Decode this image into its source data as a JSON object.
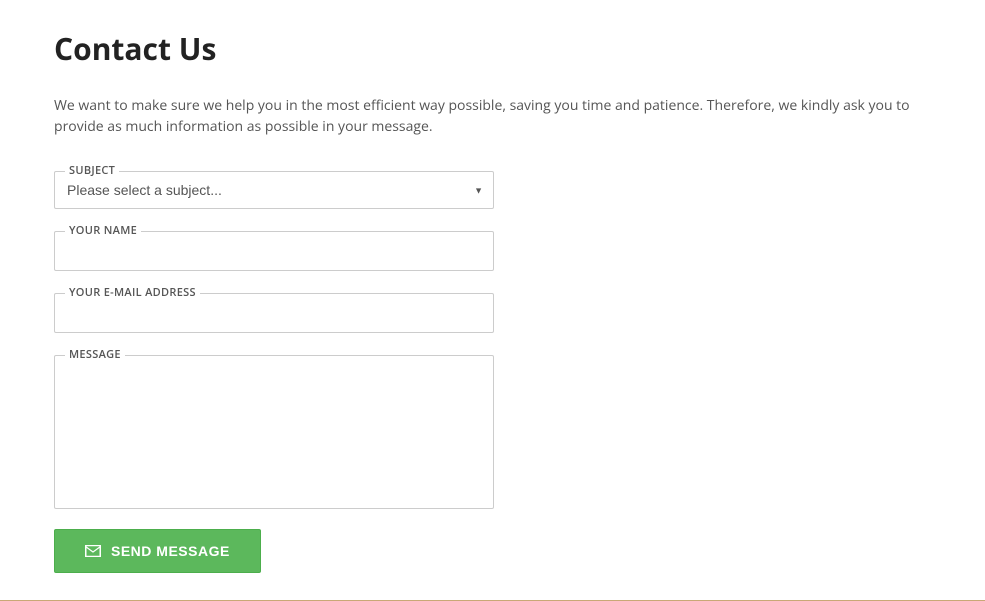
{
  "page": {
    "title": "Contact Us",
    "intro": "We want to make sure we help you in the most efficient way possible, saving you time and patience. Therefore, we kindly ask you to provide as much information as possible in your message."
  },
  "form": {
    "subject": {
      "label": "SUBJECT",
      "placeholder": "Please select a subject...",
      "value": ""
    },
    "name": {
      "label": "YOUR NAME",
      "value": ""
    },
    "email": {
      "label": "YOUR E-MAIL ADDRESS",
      "value": ""
    },
    "message": {
      "label": "MESSAGE",
      "value": ""
    },
    "sendButton": "SEND MESSAGE"
  }
}
